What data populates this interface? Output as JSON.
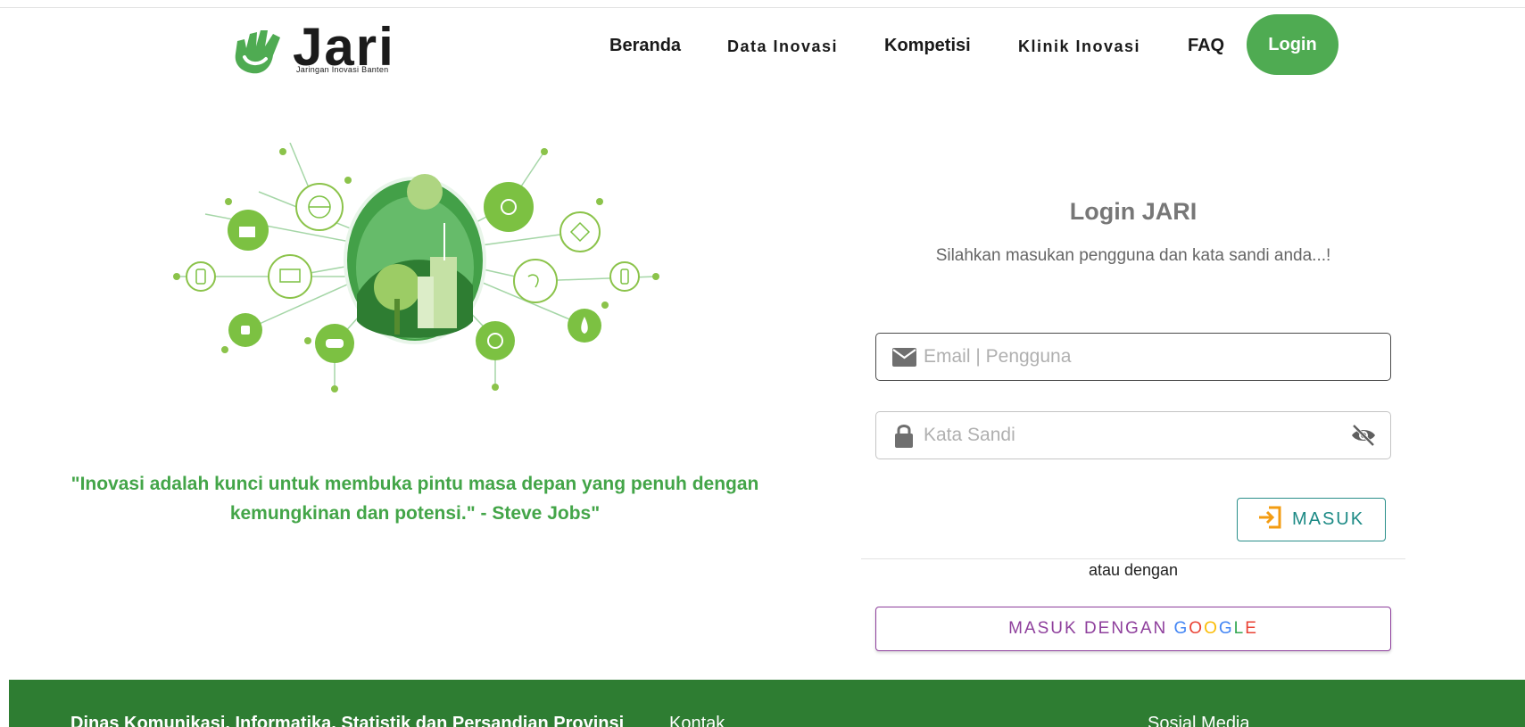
{
  "header": {
    "logo_text": "Jari",
    "logo_subtitle": "Jaringan Inovasi Banten",
    "nav": [
      {
        "label": "Beranda"
      },
      {
        "label": "Data Inovasi"
      },
      {
        "label": "Kompetisi"
      },
      {
        "label": "Klinik Inovasi"
      },
      {
        "label": "FAQ"
      }
    ],
    "login_label": "Login"
  },
  "hero": {
    "quote": "\"Inovasi adalah kunci untuk membuka pintu masa depan yang penuh dengan kemungkinan dan potensi.\" - Steve Jobs\""
  },
  "login": {
    "title": "Login JARI",
    "subtitle": "Silahkan masukan pengguna dan kata sandi anda...!",
    "email_placeholder": "Email | Pengguna",
    "password_placeholder": "Kata Sandi",
    "submit_label": "MASUK",
    "divider_text": "atau dengan",
    "google_prefix": "MASUK DENGAN ",
    "google_letters": [
      "G",
      "O",
      "O",
      "G",
      "L",
      "E"
    ]
  },
  "footer": {
    "org": "Dinas Komunikasi, Informatika, Statistik dan Persandian Provinsi",
    "contact": "Kontak",
    "social": "Sosial Media"
  },
  "colors": {
    "brand_green": "#4fab52",
    "quote_green": "#43a548",
    "footer_green": "#2e7d32",
    "masuk_teal": "#1c8a85",
    "google_purple": "#8e3f9c"
  },
  "icons": [
    "jari-hand-logo-icon",
    "envelope-icon",
    "lock-icon",
    "eye-slash-icon",
    "sign-in-icon"
  ]
}
